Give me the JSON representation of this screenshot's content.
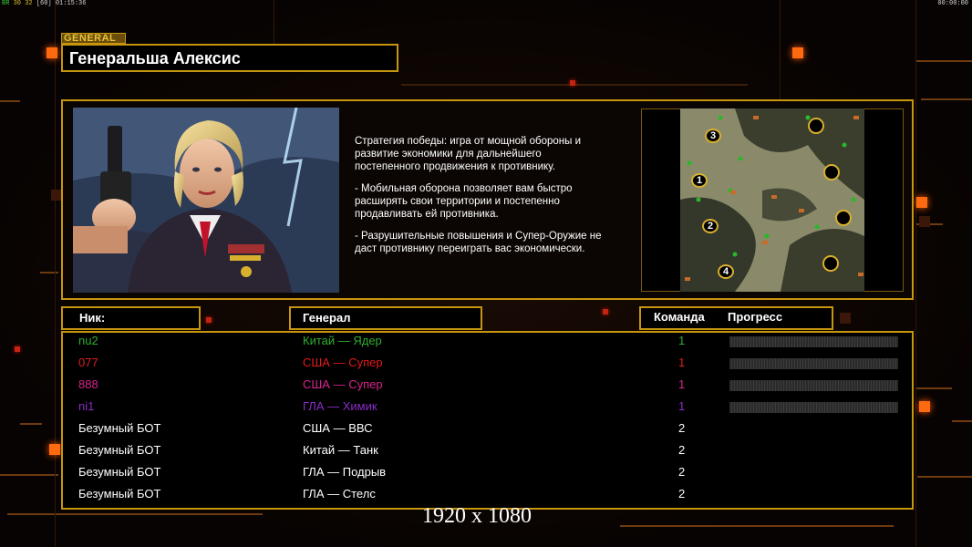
{
  "hud": {
    "top_left_a": "BR",
    "top_left_b": "30 32",
    "top_left_c": "[60]",
    "top_left_d": "01:15:36",
    "top_right": "00:00:00"
  },
  "general": {
    "tag": "GENERAL",
    "name": "Генеральша Алексис"
  },
  "description": {
    "p1": "Стратегия победы: игра от мощной обороны и\n развитие экономики для дальнейшего\n постепенного продвижения к противнику.",
    "p2": "- Мобильная оборона позволяет вам быстро\n расширять свои территории и постепенно\n продавливать ей противника.",
    "p3": "- Разрушительные повышения и Супер-Оружие не\n даст противнику переиграть вас экономически."
  },
  "map": {
    "slots": [
      "3",
      "1",
      "2",
      "4"
    ]
  },
  "headers": {
    "nick": "Ник:",
    "general": "Генерал",
    "team": "Команда",
    "progress": "Прогресс"
  },
  "players": [
    {
      "nick": "nu2",
      "general": "Китай — Ядер",
      "team": "1",
      "color": "#2fae2f",
      "human": true
    },
    {
      "nick": "077",
      "general": "США — Супер",
      "team": "1",
      "color": "#e21b1b",
      "human": true
    },
    {
      "nick": "888",
      "general": "США — Супер",
      "team": "1",
      "color": "#d6248c",
      "human": true
    },
    {
      "nick": "ni1",
      "general": "ГЛА — Химик",
      "team": "1",
      "color": "#8a2cc8",
      "human": true
    },
    {
      "nick": "Безумный БОТ",
      "general": "США — ВВС",
      "team": "2",
      "color": "#ffffff",
      "human": false
    },
    {
      "nick": "Безумный БОТ",
      "general": "Китай — Танк",
      "team": "2",
      "color": "#ffffff",
      "human": false
    },
    {
      "nick": "Безумный БОТ",
      "general": "ГЛА — Подрыв",
      "team": "2",
      "color": "#ffffff",
      "human": false
    },
    {
      "nick": "Безумный БОТ",
      "general": "ГЛА — Стелс",
      "team": "2",
      "color": "#ffffff",
      "human": false
    }
  ],
  "resolution_label": "1920 x 1080",
  "colors": {
    "frame": "#c8950e",
    "accent": "#ff6a10"
  }
}
